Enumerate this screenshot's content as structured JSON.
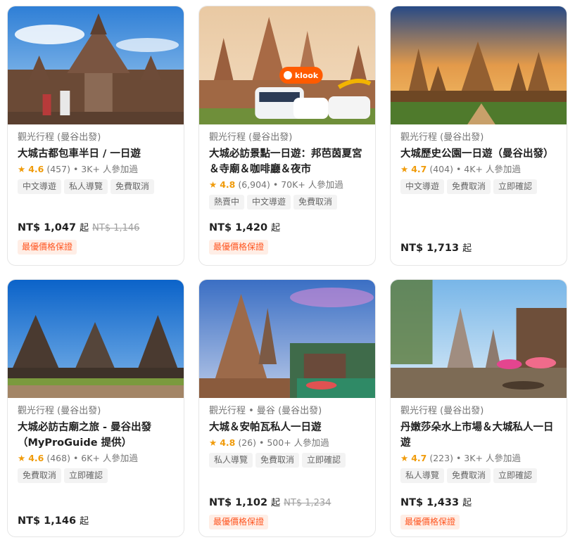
{
  "cards": [
    {
      "category": "觀光行程 (曼谷出發)",
      "title": "大城古都包車半日 / 一日遊",
      "rating_star": "★",
      "rating": "4.6",
      "reviews": "(457)",
      "booked": "• 3K+ 人參加過",
      "tags": [
        "中文導遊",
        "私人導覽",
        "免費取消"
      ],
      "price": "NT$ 1,047",
      "price_suffix": "起",
      "old_price": "NT$ 1,146",
      "badge": "最優價格保證"
    },
    {
      "category": "觀光行程 (曼谷出發)",
      "title": "大城必訪景點一日遊：邦芭茵夏宮＆寺廟＆咖啡廳＆夜市",
      "rating_star": "★",
      "rating": "4.8",
      "reviews": "(6,904)",
      "booked": "• 70K+ 人參加過",
      "tags": [
        "熱賣中",
        "中文導遊",
        "免費取消"
      ],
      "price": "NT$ 1,420",
      "price_suffix": "起",
      "badge": "最優價格保證",
      "image_logo": "klook"
    },
    {
      "category": "觀光行程 (曼谷出發)",
      "title": "大城歷史公園一日遊（曼谷出發）",
      "rating_star": "★",
      "rating": "4.7",
      "reviews": "(404)",
      "booked": "• 4K+ 人參加過",
      "tags": [
        "中文導遊",
        "免費取消",
        "立即確認"
      ],
      "price": "NT$ 1,713",
      "price_suffix": "起"
    },
    {
      "category": "觀光行程 (曼谷出發)",
      "title": "大城必訪古廟之旅 - 曼谷出發（MyProGuide 提供）",
      "rating_star": "★",
      "rating": "4.6",
      "reviews": "(468)",
      "booked": "• 6K+ 人參加過",
      "tags": [
        "免費取消",
        "立即確認"
      ],
      "price": "NT$ 1,146",
      "price_suffix": "起"
    },
    {
      "category": "觀光行程 • 曼谷 (曼谷出發)",
      "title": "大城＆安帕瓦私人一日遊",
      "rating_star": "★",
      "rating": "4.8",
      "reviews": "(26)",
      "booked": "• 500+ 人參加過",
      "tags": [
        "私人導覽",
        "免費取消",
        "立即確認"
      ],
      "price": "NT$ 1,102",
      "price_suffix": "起",
      "old_price": "NT$ 1,234",
      "badge": "最優價格保證"
    },
    {
      "category": "觀光行程 (曼谷出發)",
      "title": "丹嫩莎朵水上市場＆大城私人一日遊",
      "rating_star": "★",
      "rating": "4.7",
      "reviews": "(223)",
      "booked": "• 3K+ 人參加過",
      "tags": [
        "私人導覽",
        "免費取消",
        "立即確認"
      ],
      "price": "NT$ 1,433",
      "price_suffix": "起",
      "badge": "最優價格保證"
    }
  ]
}
